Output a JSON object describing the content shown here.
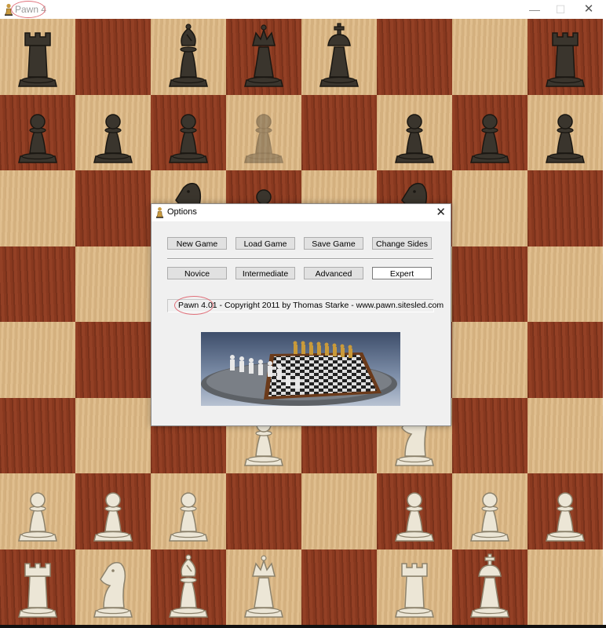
{
  "window": {
    "title": "Pawn 4",
    "minimize": "—",
    "maximize": "☐",
    "close": "✕"
  },
  "board": {
    "light_color": "#dcb987",
    "dark_color": "#8e3d22",
    "pieces": [
      {
        "type": "rook",
        "color": "black",
        "square": "a8"
      },
      {
        "type": "bishop",
        "color": "black",
        "square": "c8"
      },
      {
        "type": "queen",
        "color": "black",
        "square": "d8"
      },
      {
        "type": "king",
        "color": "black",
        "square": "e8"
      },
      {
        "type": "rook",
        "color": "black",
        "square": "h8"
      },
      {
        "type": "pawn",
        "color": "black",
        "square": "a7"
      },
      {
        "type": "pawn",
        "color": "black",
        "square": "b7"
      },
      {
        "type": "pawn",
        "color": "black",
        "square": "c7"
      },
      {
        "type": "pawn",
        "color": "black",
        "square": "d7",
        "ghost": true
      },
      {
        "type": "pawn",
        "color": "black",
        "square": "f7"
      },
      {
        "type": "pawn",
        "color": "black",
        "square": "g7"
      },
      {
        "type": "pawn",
        "color": "black",
        "square": "h7"
      },
      {
        "type": "knight",
        "color": "black",
        "square": "c6"
      },
      {
        "type": "pawn",
        "color": "black",
        "square": "d6"
      },
      {
        "type": "knight",
        "color": "black",
        "square": "f6"
      },
      {
        "type": "pawn",
        "color": "white",
        "square": "d3"
      },
      {
        "type": "knight",
        "color": "white",
        "square": "f3"
      },
      {
        "type": "pawn",
        "color": "white",
        "square": "a2"
      },
      {
        "type": "pawn",
        "color": "white",
        "square": "b2"
      },
      {
        "type": "pawn",
        "color": "white",
        "square": "c2"
      },
      {
        "type": "pawn",
        "color": "white",
        "square": "f2"
      },
      {
        "type": "pawn",
        "color": "white",
        "square": "g2"
      },
      {
        "type": "pawn",
        "color": "white",
        "square": "h2"
      },
      {
        "type": "rook",
        "color": "white",
        "square": "a1"
      },
      {
        "type": "knight",
        "color": "white",
        "square": "b1"
      },
      {
        "type": "bishop",
        "color": "white",
        "square": "c1"
      },
      {
        "type": "queen",
        "color": "white",
        "square": "d1"
      },
      {
        "type": "rook",
        "color": "white",
        "square": "f1"
      },
      {
        "type": "king",
        "color": "white",
        "square": "g1"
      }
    ]
  },
  "dialog": {
    "title": "Options",
    "close": "✕",
    "buttons_row1": [
      "New Game",
      "Load Game",
      "Save Game",
      "Change Sides"
    ],
    "buttons_row2": [
      "Novice",
      "Intermediate",
      "Advanced",
      "Expert"
    ],
    "selected_level": "Expert",
    "info": "Pawn 4.01  -  Copyright 2011 by Thomas Starke  -  www.pawn.sitesled.com"
  }
}
